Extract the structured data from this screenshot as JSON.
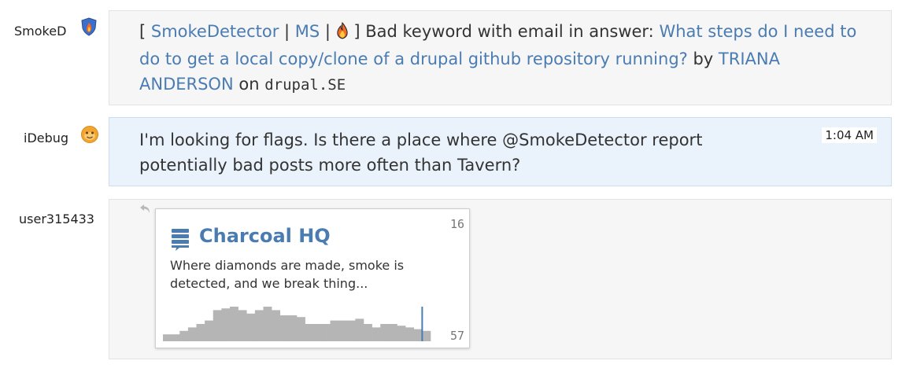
{
  "messages": [
    {
      "user": "SmokeD",
      "avatar_icon": "shield-fire-icon",
      "prefix": "[ ",
      "source_link": "SmokeDetector",
      "sep1": " | ",
      "ms_link": "MS",
      "sep2": " | ",
      "flame_icon": "flame-icon",
      "bracket_close": " ] ",
      "reason": "Bad keyword with email in answer: ",
      "post_title": "What steps do I need to do to get a local copy/clone of a drupal github repository running?",
      "by_text": " by ",
      "author": "TRIANA ANDERSON",
      "on_text": " on ",
      "site": "drupal.SE"
    },
    {
      "user": "iDebug",
      "avatar_icon": "orange-face-icon",
      "text": "I'm looking for flags. Is there a place where @SmokeDetector report potentially bad posts more often than Tavern?",
      "time": "1:04 AM"
    },
    {
      "user": "user315433",
      "reply_icon": "reply-arrow-icon",
      "card": {
        "room_icon": "room-stack-icon",
        "title": "Charcoal HQ",
        "description": "Where diamonds are made, smoke is detected, and we break thing...",
        "top_count": "16",
        "bottom_count": "57",
        "activity": [
          2,
          2,
          3,
          4,
          5,
          6,
          9,
          9.5,
          10,
          9,
          8,
          9,
          10,
          9,
          7.5,
          7.5,
          7,
          5,
          5,
          5,
          6,
          6,
          6,
          6.5,
          5,
          4,
          5,
          5,
          4.5,
          4,
          3.5,
          3
        ],
        "activity_color": "#b5b5b5",
        "marker_color": "#4a7cb2"
      }
    }
  ],
  "colors": {
    "link": "#4a7cb2",
    "mine_background": "#eaf3fb"
  }
}
